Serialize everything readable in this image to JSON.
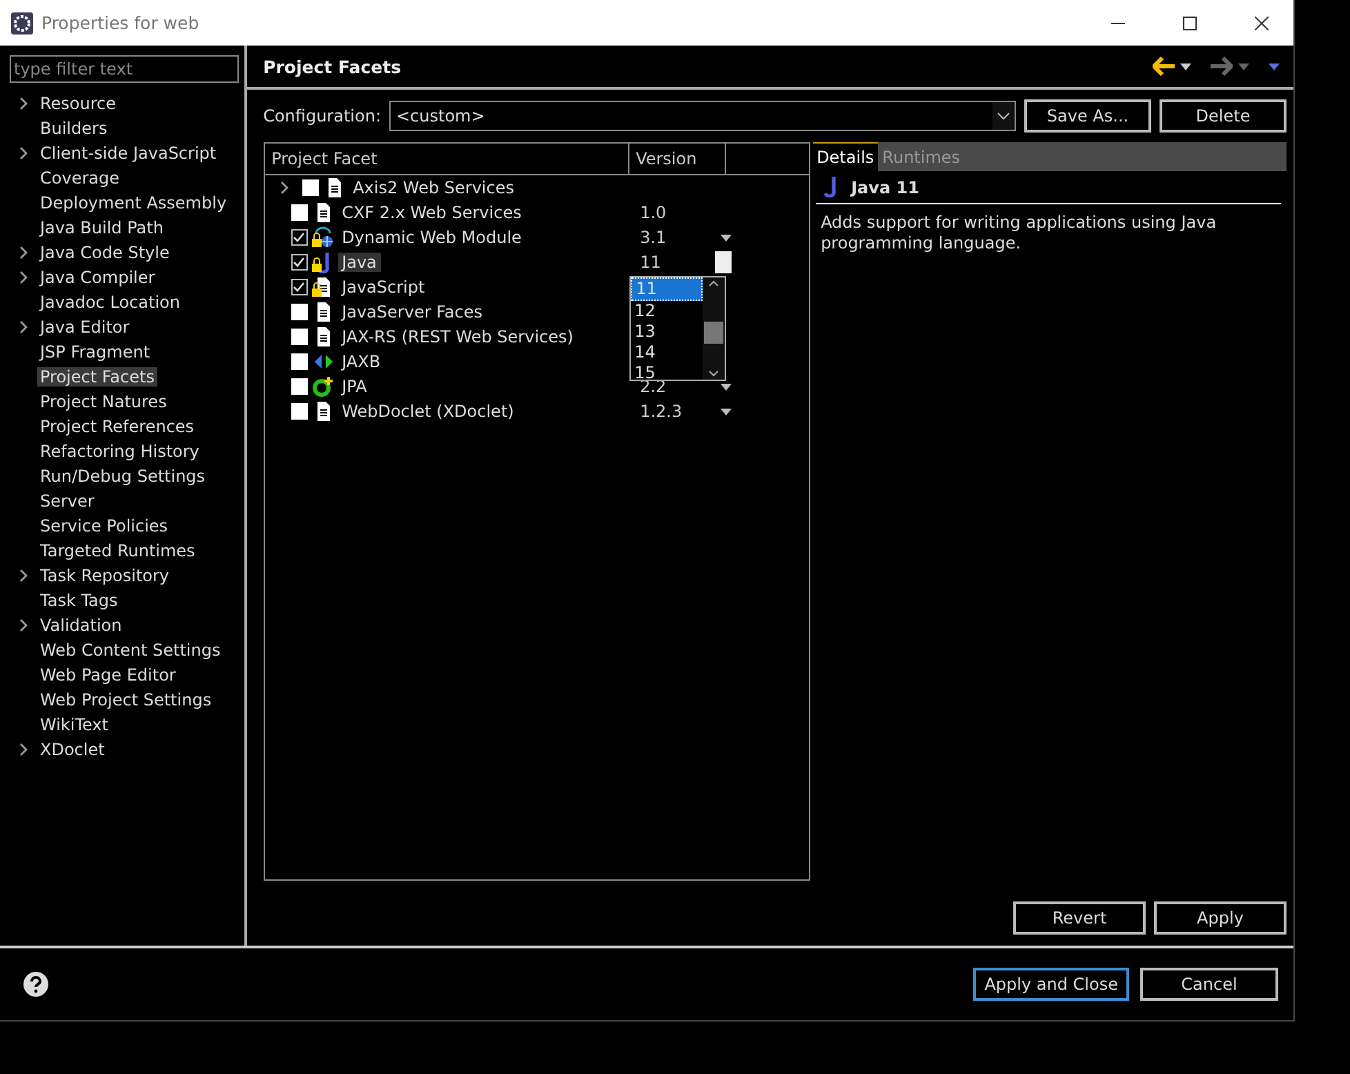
{
  "window": {
    "title": "Properties for web"
  },
  "filter": {
    "placeholder": "type filter text"
  },
  "sidebar": {
    "items": [
      {
        "label": "Resource",
        "expandable": true,
        "selected": false
      },
      {
        "label": "Builders",
        "expandable": false,
        "selected": false
      },
      {
        "label": "Client-side JavaScript",
        "expandable": true,
        "selected": false
      },
      {
        "label": "Coverage",
        "expandable": false,
        "selected": false
      },
      {
        "label": "Deployment Assembly",
        "expandable": false,
        "selected": false
      },
      {
        "label": "Java Build Path",
        "expandable": false,
        "selected": false
      },
      {
        "label": "Java Code Style",
        "expandable": true,
        "selected": false
      },
      {
        "label": "Java Compiler",
        "expandable": true,
        "selected": false
      },
      {
        "label": "Javadoc Location",
        "expandable": false,
        "selected": false
      },
      {
        "label": "Java Editor",
        "expandable": true,
        "selected": false
      },
      {
        "label": "JSP Fragment",
        "expandable": false,
        "selected": false
      },
      {
        "label": "Project Facets",
        "expandable": false,
        "selected": true
      },
      {
        "label": "Project Natures",
        "expandable": false,
        "selected": false
      },
      {
        "label": "Project References",
        "expandable": false,
        "selected": false
      },
      {
        "label": "Refactoring History",
        "expandable": false,
        "selected": false
      },
      {
        "label": "Run/Debug Settings",
        "expandable": false,
        "selected": false
      },
      {
        "label": "Server",
        "expandable": false,
        "selected": false
      },
      {
        "label": "Service Policies",
        "expandable": false,
        "selected": false
      },
      {
        "label": "Targeted Runtimes",
        "expandable": false,
        "selected": false
      },
      {
        "label": "Task Repository",
        "expandable": true,
        "selected": false
      },
      {
        "label": "Task Tags",
        "expandable": false,
        "selected": false
      },
      {
        "label": "Validation",
        "expandable": true,
        "selected": false
      },
      {
        "label": "Web Content Settings",
        "expandable": false,
        "selected": false
      },
      {
        "label": "Web Page Editor",
        "expandable": false,
        "selected": false
      },
      {
        "label": "Web Project Settings",
        "expandable": false,
        "selected": false
      },
      {
        "label": "WikiText",
        "expandable": false,
        "selected": false
      },
      {
        "label": "XDoclet",
        "expandable": true,
        "selected": false
      }
    ]
  },
  "page": {
    "title": "Project Facets"
  },
  "configuration": {
    "label": "Configuration:",
    "value": "<custom>",
    "buttons": [
      "Save As...",
      "Delete"
    ]
  },
  "table": {
    "columns": [
      "Project Facet",
      "Version"
    ],
    "rows": [
      {
        "name": "Axis2 Web Services",
        "kind": "document",
        "checked": false,
        "locked": false,
        "expandable": true,
        "selected": false
      },
      {
        "name": "CXF 2.x Web Services",
        "kind": "document",
        "checked": false,
        "locked": false,
        "expandable": false,
        "selected": false,
        "version": "1.0",
        "dropdown": false
      },
      {
        "name": "Dynamic Web Module",
        "kind": "globe",
        "checked": true,
        "locked": true,
        "expandable": false,
        "selected": false,
        "version": "3.1",
        "dropdown": true
      },
      {
        "name": "Java",
        "kind": "java",
        "checked": true,
        "locked": true,
        "expandable": false,
        "selected": true,
        "version": "11",
        "dropdown": true
      },
      {
        "name": "JavaScript",
        "kind": "document",
        "checked": true,
        "locked": true,
        "expandable": false,
        "selected": false
      },
      {
        "name": "JavaServer Faces",
        "kind": "document",
        "checked": false,
        "locked": false,
        "expandable": false,
        "selected": false
      },
      {
        "name": "JAX-RS (REST Web Services)",
        "kind": "document",
        "checked": false,
        "locked": false,
        "expandable": false,
        "selected": false
      },
      {
        "name": "JAXB",
        "kind": "arrows",
        "checked": false,
        "locked": false,
        "expandable": false,
        "selected": false
      },
      {
        "name": "JPA",
        "kind": "persistence",
        "checked": false,
        "locked": false,
        "expandable": false,
        "selected": false,
        "version": "2.2",
        "dropdown": true
      },
      {
        "name": "WebDoclet (XDoclet)",
        "kind": "document",
        "checked": false,
        "locked": false,
        "expandable": false,
        "selected": false,
        "version": "1.2.3",
        "dropdown": true
      }
    ]
  },
  "version_list": {
    "options": [
      {
        "label": "11",
        "selected": true
      },
      {
        "label": "12",
        "selected": false
      },
      {
        "label": "13",
        "selected": false
      },
      {
        "label": "14",
        "selected": false
      },
      {
        "label": "15",
        "selected": false
      }
    ]
  },
  "details": {
    "tabs": [
      {
        "label": "Details",
        "selected": true
      },
      {
        "label": "Runtimes",
        "selected": false
      }
    ],
    "title": "Java 11",
    "description": "Adds support for writing applications using Java programming language."
  },
  "page_buttons": [
    "Revert",
    "Apply"
  ],
  "dialog_buttons": [
    {
      "label": "Apply and Close",
      "default": true
    },
    {
      "label": "Cancel",
      "default": false
    }
  ]
}
